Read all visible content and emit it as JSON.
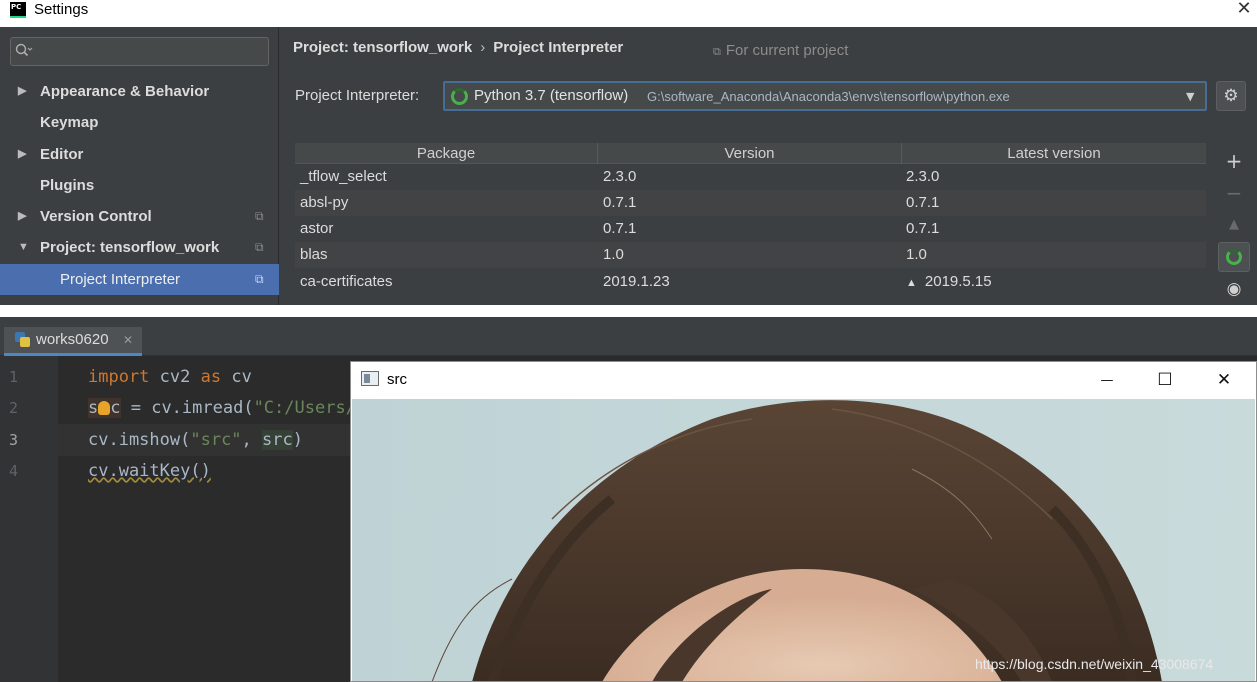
{
  "settings": {
    "title": "Settings",
    "close_glyph": "✕",
    "app_logo_text": "PC",
    "search": {
      "placeholder": "",
      "icon": "search-icon"
    },
    "sidebar": {
      "items": [
        {
          "label": "Appearance & Behavior",
          "arrow": "▶",
          "copy": ""
        },
        {
          "label": "Keymap",
          "arrow": "",
          "copy": ""
        },
        {
          "label": "Editor",
          "arrow": "▶",
          "copy": ""
        },
        {
          "label": "Plugins",
          "arrow": "",
          "copy": ""
        },
        {
          "label": "Version Control",
          "arrow": "▶",
          "copy": "⧉"
        },
        {
          "label": "Project: tensorflow_work",
          "arrow": "▼",
          "copy": "⧉"
        },
        {
          "label": "Project Interpreter",
          "arrow": "",
          "copy": "⧉"
        }
      ]
    },
    "breadcrumb": {
      "project": "Project: tensorflow_work",
      "separator": "›",
      "page": "Project Interpreter"
    },
    "scope": {
      "icon": "⧉",
      "label": "For current project"
    },
    "interpreter": {
      "label": "Project Interpreter:",
      "name": "Python 3.7 (tensorflow)",
      "path": "G:\\software_Anaconda\\Anaconda3\\envs\\tensorflow\\python.exe",
      "dropdown_glyph": "▼",
      "gear_glyph": "⚙"
    },
    "packages": {
      "columns": [
        "Package",
        "Version",
        "Latest version"
      ],
      "rows": [
        {
          "package": "_tflow_select",
          "version": "2.3.0",
          "latest": "2.3.0",
          "upgrade": ""
        },
        {
          "package": "absl-py",
          "version": "0.7.1",
          "latest": "0.7.1",
          "upgrade": ""
        },
        {
          "package": "astor",
          "version": "0.7.1",
          "latest": "0.7.1",
          "upgrade": ""
        },
        {
          "package": "blas",
          "version": "1.0",
          "latest": "1.0",
          "upgrade": ""
        },
        {
          "package": "ca-certificates",
          "version": "2019.1.23",
          "latest": "2019.5.15",
          "upgrade": "▲"
        }
      ]
    },
    "tools": {
      "add": "+",
      "remove": "−",
      "upgrade": "▲",
      "show": "◉"
    }
  },
  "editor": {
    "tab": {
      "label": "works0620",
      "close": "✕"
    },
    "line_numbers": [
      "1",
      "2",
      "3",
      "4"
    ],
    "code": {
      "line1_kw1": "import",
      "line1_mod": " cv2 ",
      "line1_kw2": "as",
      "line1_alias": " cv",
      "line2_a": "s",
      "line2_b": "c",
      "line2_rest": " = cv.imread(",
      "line2_str": "\"C:/Users/",
      "line3_a": "cv.imshow(",
      "line3_str": "\"src\"",
      "line3_b": ", ",
      "line3_var": "src",
      "line3_c": ")",
      "line4": "cv.waitKey()"
    }
  },
  "image_window": {
    "title": "src",
    "minimize": "—",
    "maximize": "☐",
    "close": "✕"
  },
  "watermark": "https://blog.csdn.net/weixin_43008674",
  "colors": {
    "selection": "#4b6eaf",
    "keyword": "#cc7832",
    "string": "#6a8759",
    "ide_bg": "#2b2b2b",
    "panel_bg": "#3c3f41"
  }
}
